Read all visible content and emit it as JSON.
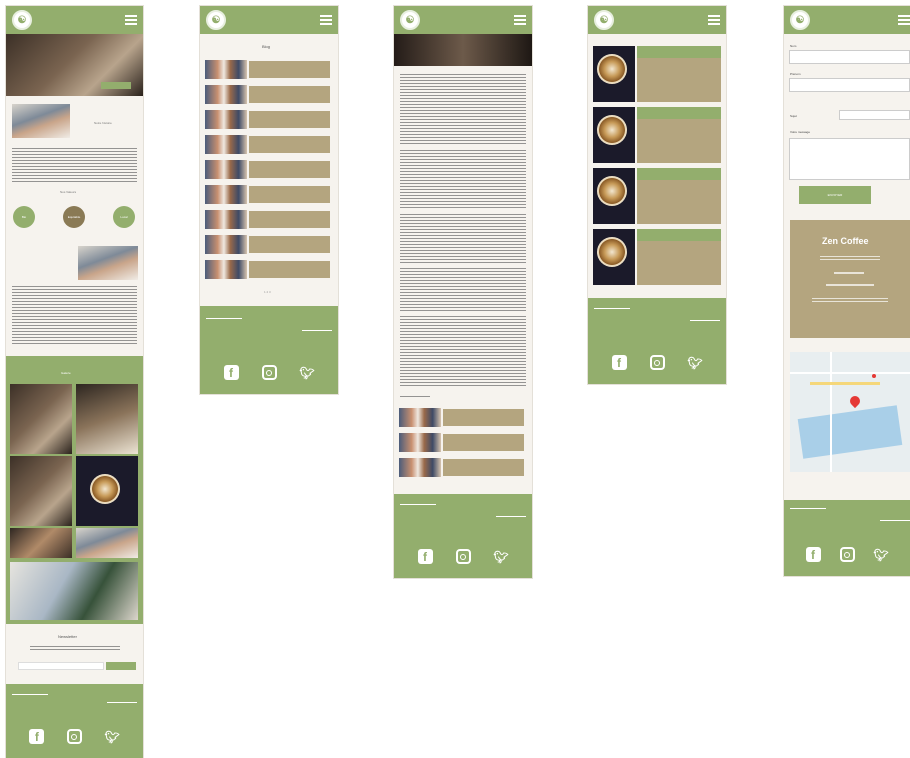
{
  "colors": {
    "accent": "#93ae6d",
    "tan": "#b4a57f",
    "background": "#f6f3ee"
  },
  "icons": [
    "menu-icon",
    "facebook-icon",
    "instagram-icon",
    "twitter-icon",
    "map-pin-icon"
  ],
  "home": {
    "section_title_1": "Nos Valeurs",
    "about_title": "Notre histoire",
    "circle_labels": [
      "Bio",
      "Equitable",
      "Local"
    ],
    "gallery_title": "Galerie",
    "newsletter_title": "Newsletter"
  },
  "blog": {
    "title": "Blog",
    "pagination": "1 2 3"
  },
  "contact": {
    "fields": [
      "Nom",
      "Prénom",
      "Sujet",
      "Votre message"
    ],
    "submit": "ENVOYER",
    "shop_name": "Zen Coffee"
  }
}
